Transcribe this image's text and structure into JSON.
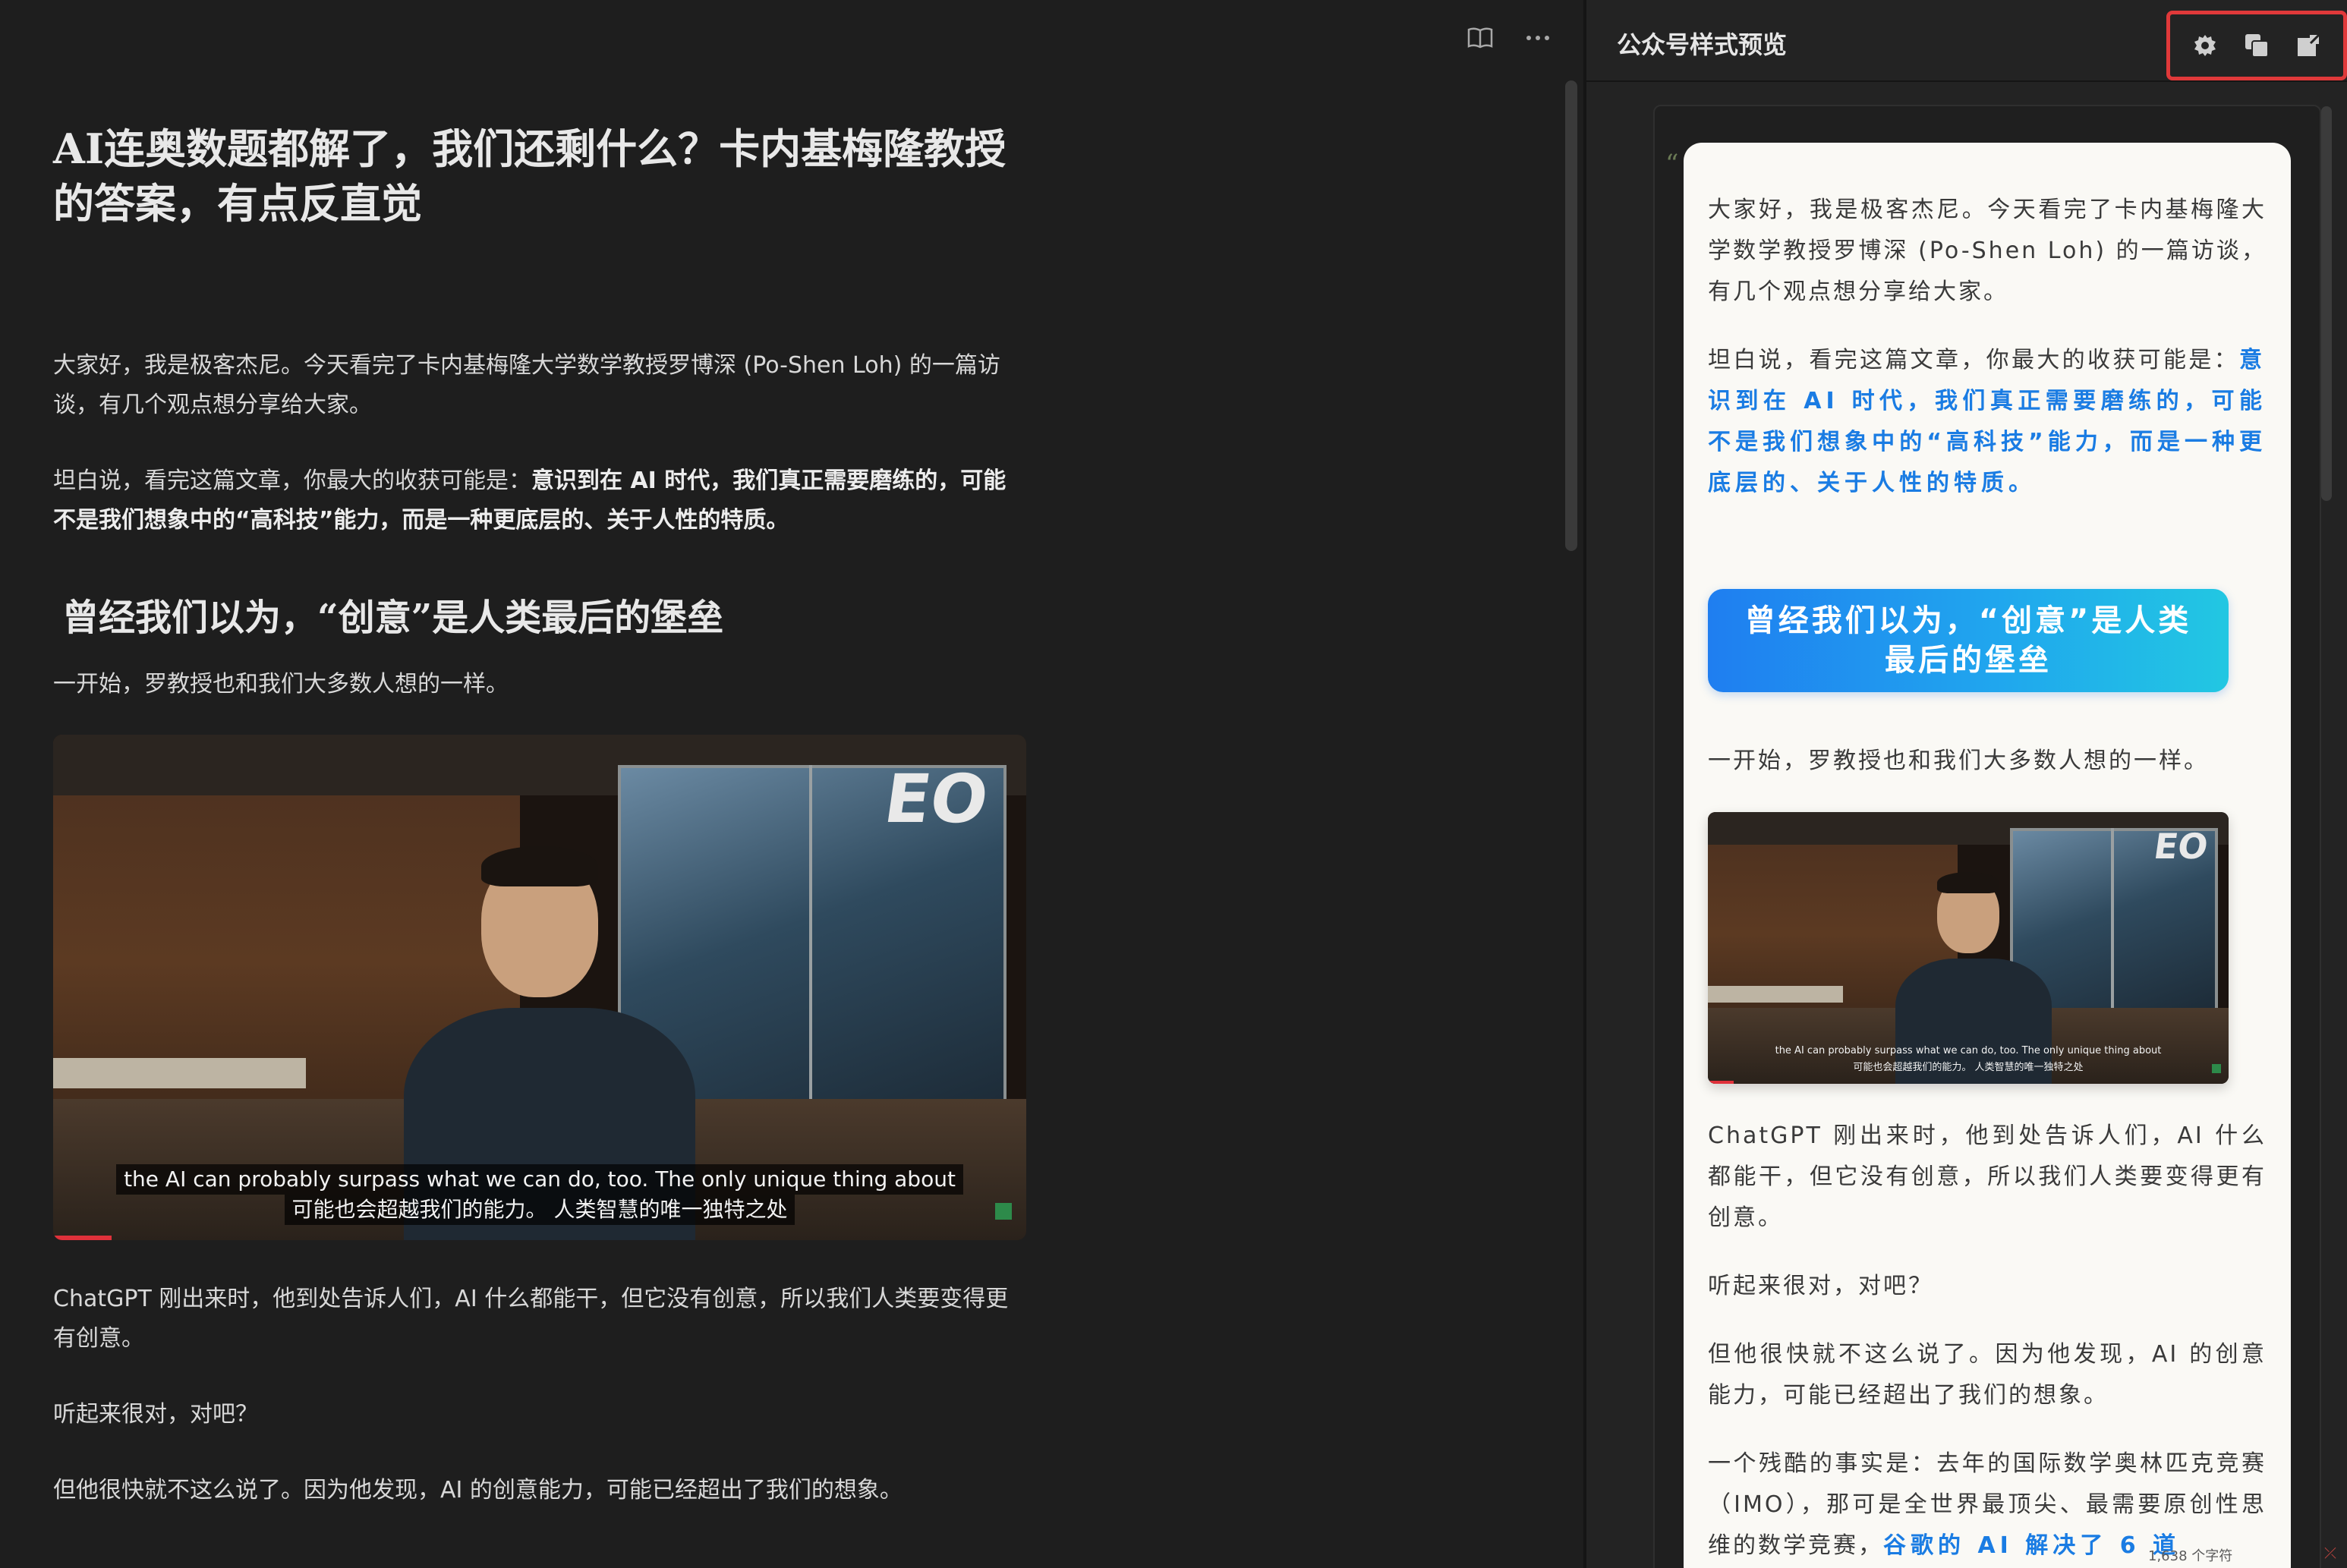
{
  "editor": {
    "toolbar": {
      "reading_icon": "book-open-icon",
      "more_icon": "more-horizontal-icon"
    },
    "title": "AI连奥数题都解了，我们还剩什么？卡内基梅隆教授的答案，有点反直觉",
    "p1": "大家好，我是极客杰尼。今天看完了卡内基梅隆大学数学教授罗博深 (Po-Shen Loh) 的一篇访谈，有几个观点想分享给大家。",
    "p2_prefix": "坦白说，看完这篇文章，你最大的收获可能是：",
    "p2_strong": "意识到在 AI 时代，我们真正需要磨练的，可能不是我们想象中的“高科技”能力，而是一种更底层的、关于人性的特质。",
    "h2": "曾经我们以为，“创意”是人类最后的堡垒",
    "p3": "一开始，罗教授也和我们大多数人想的一样。",
    "video": {
      "logo": "EO",
      "sub_en": "the AI can probably surpass what we can do, too. The only unique thing about",
      "sub_zh": "可能也会超越我们的能力。 人类智慧的唯一独特之处"
    },
    "p4": "ChatGPT 刚出来时，他到处告诉人们，AI 什么都能干，但它没有创意，所以我们人类要变得更有创意。",
    "p5": "听起来很对，对吧？",
    "p6": "但他很快就不这么说了。因为他发现，AI 的创意能力，可能已经超出了我们的想象。"
  },
  "preview": {
    "title": "公众号样式预览",
    "actions": [
      {
        "name": "settings-icon"
      },
      {
        "name": "copy-icon"
      },
      {
        "name": "export-icon"
      }
    ],
    "quote_mark": "“",
    "p1": "大家好，我是极客杰尼。今天看完了卡内基梅隆大学数学教授罗博深 (Po-Shen Loh) 的一篇访谈，有几个观点想分享给大家。",
    "p2_prefix": "坦白说，看完这篇文章，你最大的收获可能是：",
    "p2_strong": "意识到在 AI 时代，我们真正需要磨练的，可能不是我们想象中的“高科技”能力，而是一种更底层的、关于人性的特质。",
    "h2": "曾经我们以为，“创意”是人类最后的堡垒",
    "p3": "一开始，罗教授也和我们大多数人想的一样。",
    "p4": "ChatGPT 刚出来时，他到处告诉人们，AI 什么都能干，但它没有创意，所以我们人类要变得更有创意。",
    "p5": "听起来很对，对吧？",
    "p6": "但他很快就不这么说了。因为他发现，AI 的创意能力，可能已经超出了我们的想象。",
    "p7_prefix": "一个残酷的事实是：去年的国际数学奥林匹克竞赛（IMO），那可是全世界最顶尖、最需要原创性思维的数学竞赛，",
    "p7_strong": "谷歌的 AI 解决了 6 道",
    "accent_color": "#1a7ce3"
  },
  "status": {
    "text": "1,638 个字符"
  }
}
